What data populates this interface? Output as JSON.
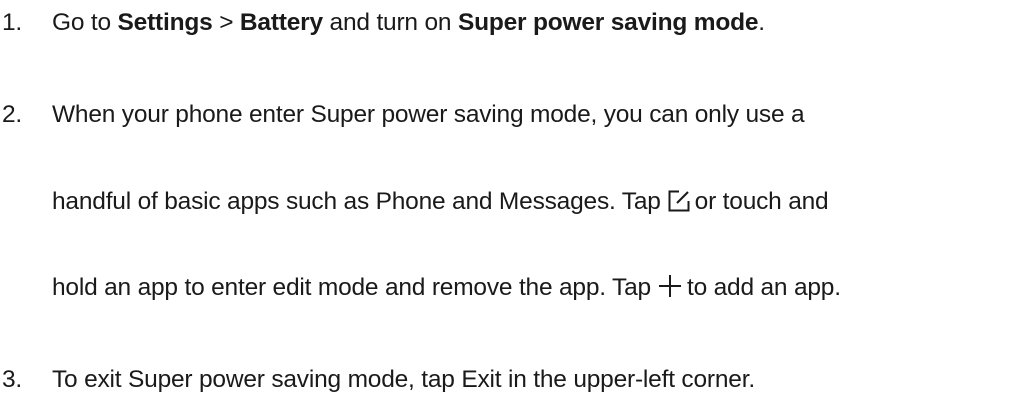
{
  "steps": [
    {
      "number": "1.",
      "parts": {
        "a": "Go to ",
        "settings": "Settings",
        "sep": " > ",
        "battery": "Battery",
        "b": " and turn on ",
        "mode": "Super power saving mode",
        "c": "."
      }
    },
    {
      "number": "2.",
      "line1": "When your phone enter Super power saving mode, you can only use a",
      "line2a": "handful of basic apps such as Phone and Messages. Tap",
      "line2b": "or touch and",
      "line3a": "hold an app to enter edit mode and remove the app. Tap",
      "line3b": "to add an app."
    },
    {
      "number": "3.",
      "line1": "To exit Super power saving mode, tap Exit in the upper-left corner."
    }
  ],
  "icons": {
    "edit": "edit-icon",
    "add": "plus-icon"
  },
  "colors": {
    "text": "#1a1a1a",
    "background": "#ffffff"
  }
}
